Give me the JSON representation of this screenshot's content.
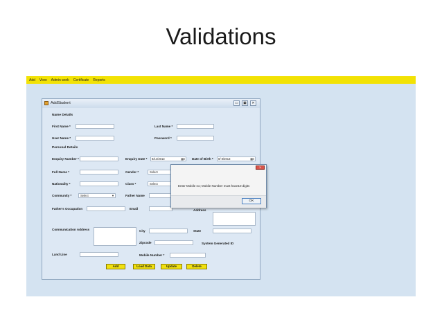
{
  "slide": {
    "title": "Validations"
  },
  "menu": [
    "Add",
    "View",
    "Admin work",
    "Certificate",
    "Reports"
  ],
  "window": {
    "title": "AddStudent",
    "min": "▭",
    "max": "▣",
    "close": "✕"
  },
  "sections": {
    "name_details": "Name Details",
    "personal_details": "Personal Details"
  },
  "labels": {
    "first_name": "First Name *",
    "last_name": "Last Name *",
    "user_name": "User Name *",
    "password": "Password *",
    "enquiry_number": "Enquiry Number *",
    "enquiry_date": "Enquiry Date *",
    "date_of_birth": "Date of Birth *",
    "full_name": "Full Name *",
    "gender": "Gender *",
    "nationality": "Nationality *",
    "class": "Class *",
    "community": "Community *",
    "father_name": "Father Name",
    "fathers_occupation": "Father's Occupation",
    "email": "Email",
    "address_right": "Address",
    "communication_address": "Communication Address",
    "city": "City",
    "state": "State",
    "zipcode": "Zipcode",
    "system_generated_id": "System Generated ID",
    "land_line": "Land Line",
    "mobile_number": "Mobile Number *"
  },
  "fields": {
    "enquiry_date": "8/14/2013",
    "date_of_birth": "8/ 8/2013",
    "gender": "Select",
    "class": "Select",
    "community": "Select"
  },
  "buttons": {
    "add": "Add",
    "load_data": "Load Data",
    "update": "Update",
    "delete": "Delete"
  },
  "dialog": {
    "close": "x",
    "message": "Enter Mobile no; Mobile Number must have10 digits",
    "ok": "OK"
  },
  "colors": {
    "menubar": "#f2e205",
    "background": "#d4e3f1",
    "button": "#f0e010"
  }
}
